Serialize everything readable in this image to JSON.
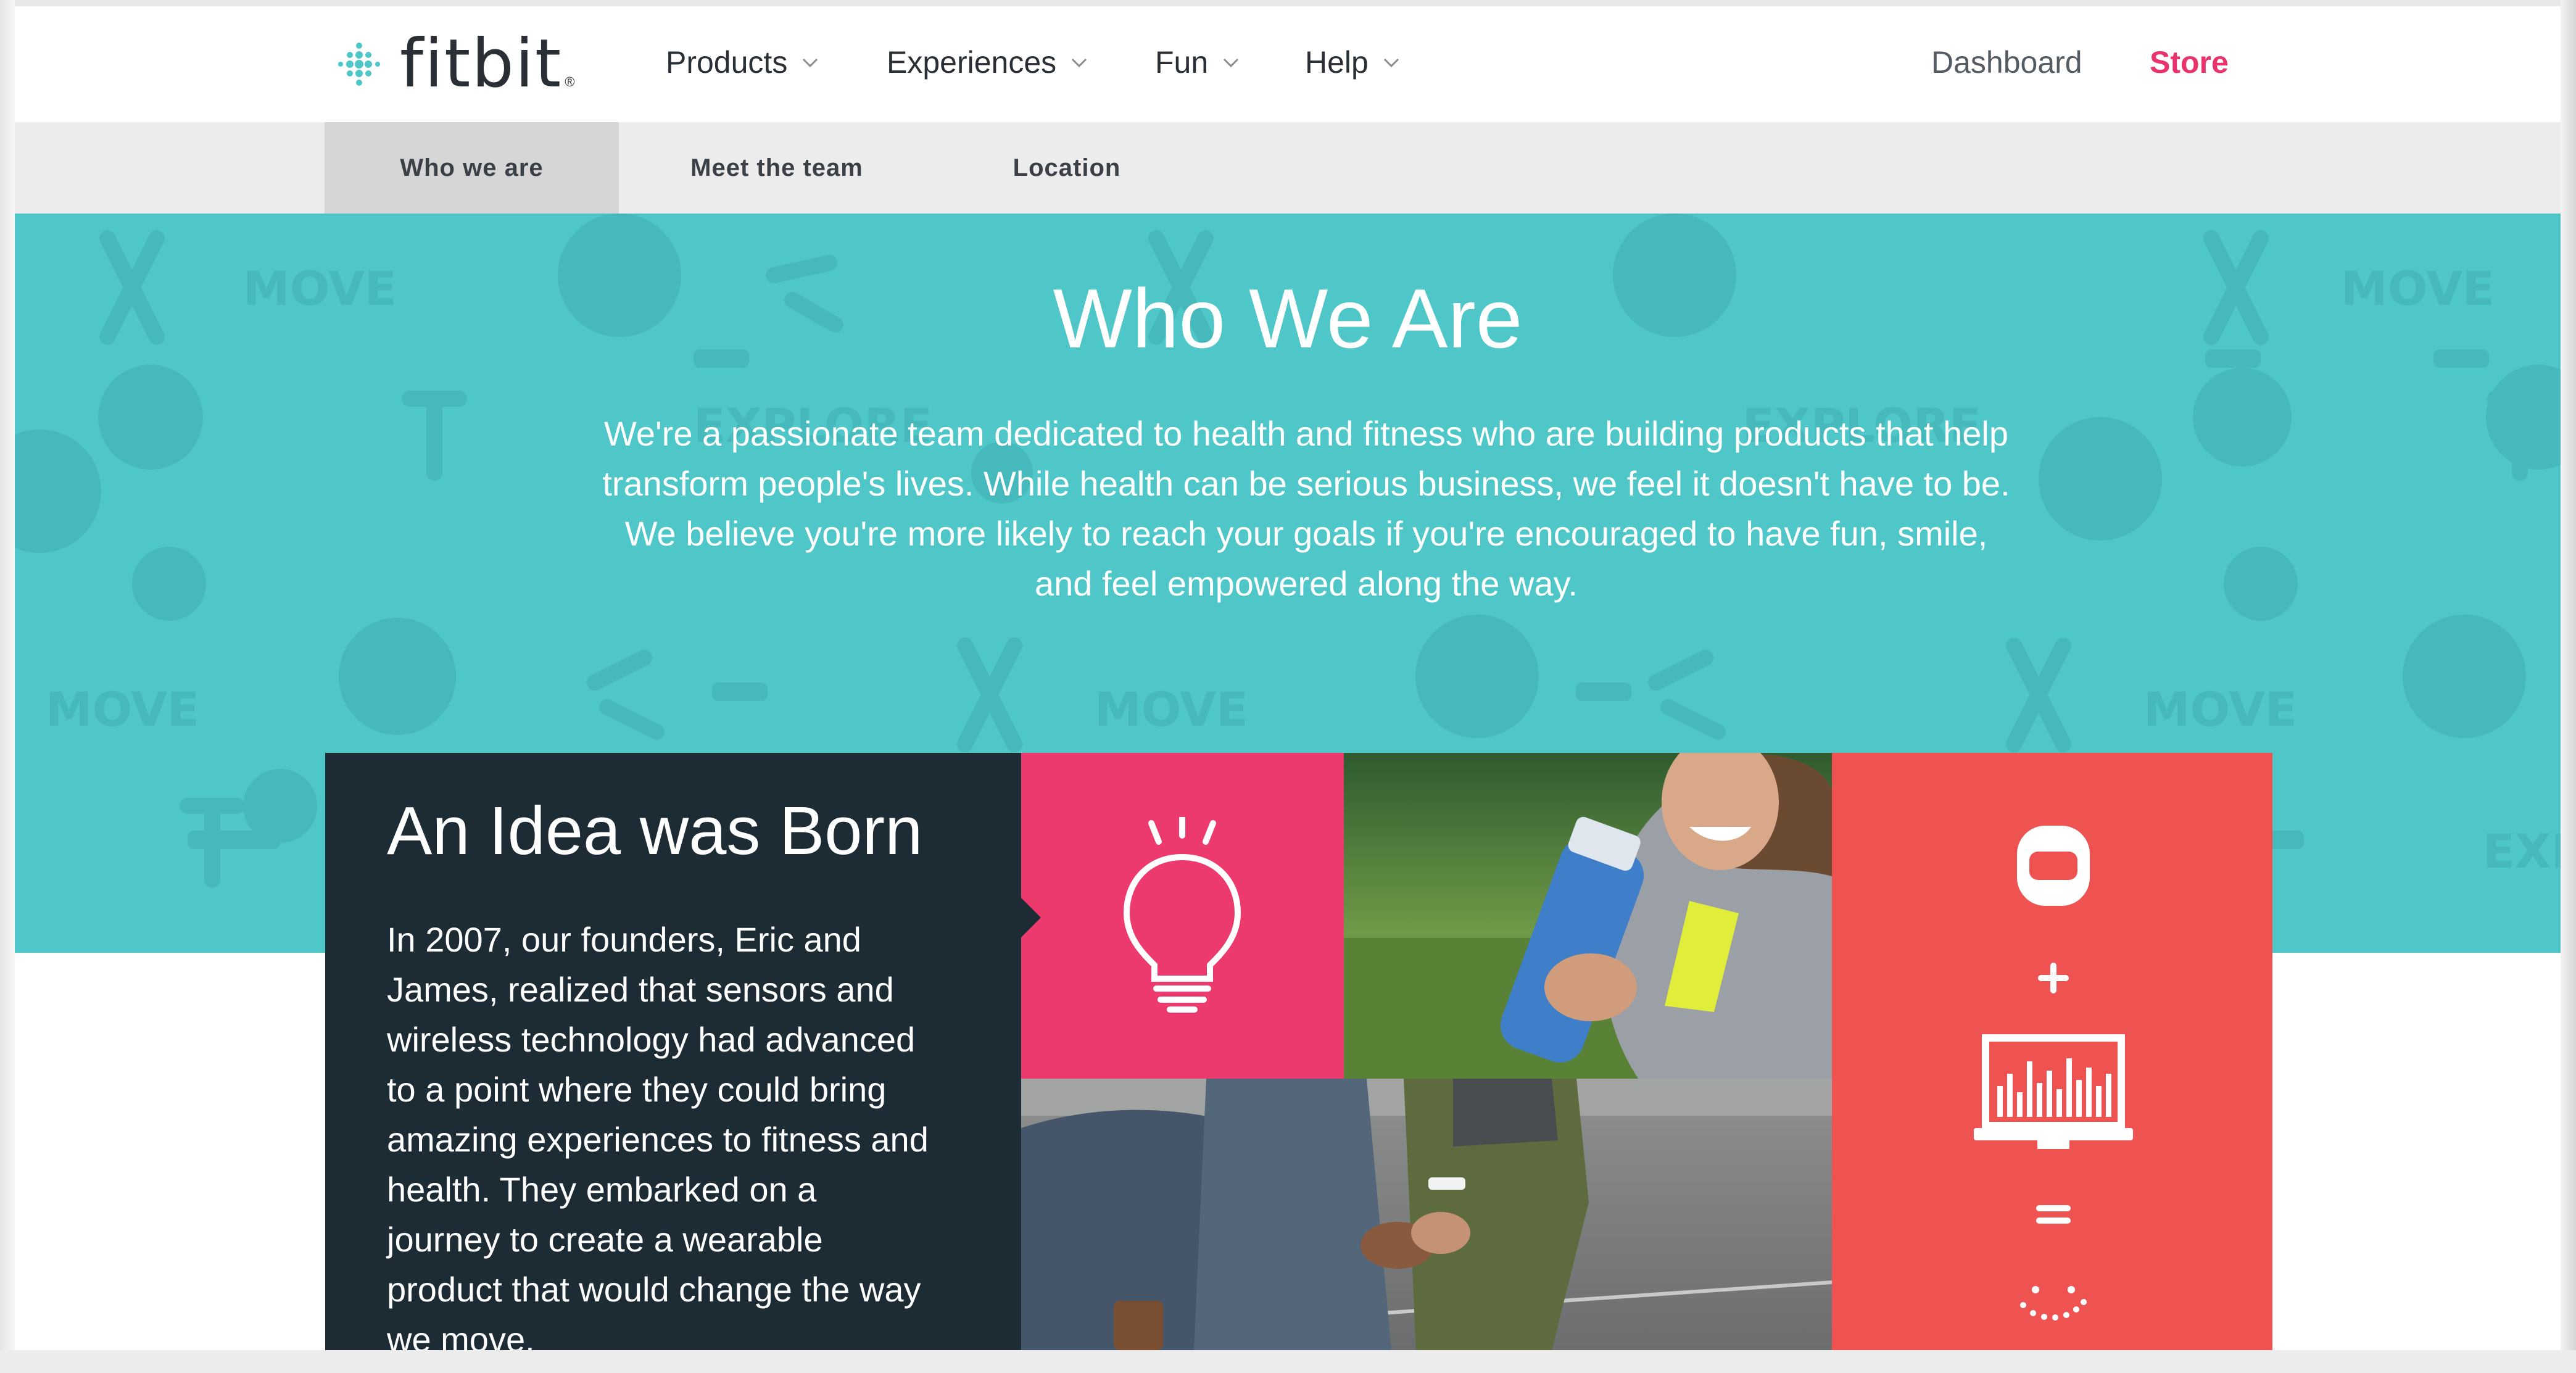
{
  "header": {
    "logo_text": "fitbit",
    "logo_mark": "®",
    "nav": [
      {
        "label": "Products",
        "icon": "chevron-down-icon"
      },
      {
        "label": "Experiences",
        "icon": "chevron-down-icon"
      },
      {
        "label": "Fun",
        "icon": "chevron-down-icon"
      },
      {
        "label": "Help",
        "icon": "chevron-down-icon"
      }
    ],
    "dashboard_label": "Dashboard",
    "store_label": "Store"
  },
  "subnav": {
    "tabs": [
      {
        "label": "Who we are",
        "active": true
      },
      {
        "label": "Meet the team",
        "active": false
      },
      {
        "label": "Location",
        "active": false
      }
    ]
  },
  "hero": {
    "title": "Who We Are",
    "text_lines": [
      "We're a passionate team dedicated to health and fitness who are building products that help",
      "transform people's lives. While health can be serious business, we feel it doesn't have to be.",
      "We believe you're more likely to reach your goals if you're encouraged to have fun, smile,",
      "and feel empowered along the way."
    ],
    "pattern_word": "MOVE",
    "background_color": "#4fc7c9"
  },
  "story": {
    "title": "An Idea was Born",
    "text_lines": [
      "In 2007, our founders, Eric and",
      "James, realized that sensors and",
      "wireless technology had advanced",
      "to a point where they could bring",
      "amazing experiences to fitness and",
      "health. They embarked on a",
      "journey to create a wearable",
      "product that would change the way",
      "we move."
    ]
  },
  "panel_icons": {
    "idea": "lightbulb-icon",
    "equation": [
      "tracker-icon",
      "plus-icon",
      "monitor-chart-icon",
      "equals-icon",
      "smile-icon"
    ]
  },
  "colors": {
    "brand_teal": "#4fc7c9",
    "store_pink": "#e8336b",
    "bulb_pink": "#ec3a6e",
    "equation_red": "#ef5351",
    "story_dark": "#1d2b34"
  }
}
